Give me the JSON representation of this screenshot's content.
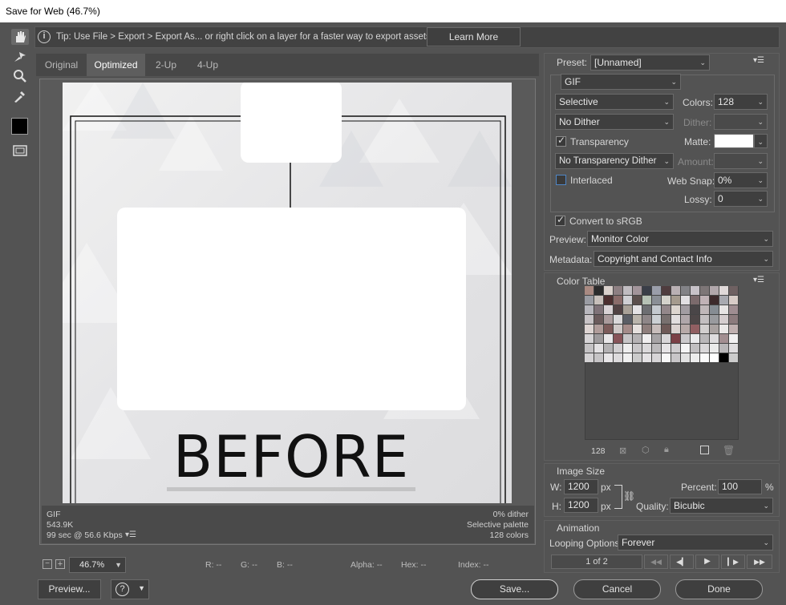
{
  "window": {
    "title": "Save for Web (46.7%)"
  },
  "tip": {
    "text": "Tip: Use File > Export > Export As...  or right click on a layer for a faster way to export assets",
    "learn_more": "Learn More"
  },
  "tools": [
    "hand-tool-icon",
    "slice-select-tool-icon",
    "zoom-tool-icon",
    "eyedropper-tool-icon",
    "eyedropper-color-swatch",
    "toggle-slices-icon"
  ],
  "tabs": [
    {
      "label": "Original"
    },
    {
      "label": "Optimized"
    },
    {
      "label": "2-Up"
    },
    {
      "label": "4-Up"
    }
  ],
  "preview_image": {
    "heading": "BEFORE"
  },
  "info": {
    "format": "GIF",
    "size": "543.9K",
    "time": "99 sec @ 56.6 Kbps",
    "dither": "0% dither",
    "palette": "Selective palette",
    "colors": "128 colors"
  },
  "status": {
    "zoom": "46.7%",
    "r": "R: --",
    "g": "G: --",
    "b": "B: --",
    "alpha": "Alpha: --",
    "hex": "Hex: --",
    "index": "Index: --"
  },
  "bottom_buttons": {
    "preview": "Preview...",
    "save": "Save...",
    "cancel": "Cancel",
    "done": "Done"
  },
  "preset": {
    "label": "Preset:",
    "value": "[Unnamed]"
  },
  "optimize": {
    "format": "GIF",
    "reduction": "Selective",
    "colors_label": "Colors:",
    "colors": "128",
    "dither_algo": "No Dither",
    "dither_label": "Dither:",
    "transparency_label": "Transparency",
    "transparency_checked": true,
    "matte_label": "Matte:",
    "transparency_dither": "No Transparency Dither",
    "amount_label": "Amount:",
    "interlaced_label": "Interlaced",
    "interlaced_checked": false,
    "websnap_label": "Web Snap:",
    "websnap": "0%",
    "lossy_label": "Lossy:",
    "lossy": "0"
  },
  "convert_srgb": {
    "label": "Convert to sRGB",
    "checked": true
  },
  "preview_setting": {
    "label": "Preview:",
    "value": "Monitor Color"
  },
  "metadata": {
    "label": "Metadata:",
    "value": "Copyright and Contact Info"
  },
  "color_table": {
    "title": "Color Table",
    "count": "128",
    "colors": [
      "#a98a82",
      "#2b2b2b",
      "#d9d0cb",
      "#8d7f82",
      "#c0bcc0",
      "#a2949a",
      "#3a3e48",
      "#9a9eaa",
      "#4f3c3e",
      "#b9b0b3",
      "#838387",
      "#c7c2c8",
      "#7d7677",
      "#b1a7ab",
      "#e0d9d9",
      "#6f6162",
      "#9a9ca3",
      "#c7bfba",
      "#4c2f2f",
      "#8a6c6a",
      "#cfcfd3",
      "#5b4f4d",
      "#b6c1b5",
      "#8a8f96",
      "#d4d2cb",
      "#a59b8e",
      "#e2e0e3",
      "#7b6a6c",
      "#c0b2b6",
      "#3d2a2c",
      "#a8a9b0",
      "#d8ccc7",
      "#b8b7bd",
      "#7f7278",
      "#d9d2d5",
      "#514243",
      "#a8a097",
      "#e4e2e5",
      "#6d6e72",
      "#c4c9cf",
      "#93878a",
      "#dcd5cf",
      "#a29da2",
      "#4a4648",
      "#bfb7b9",
      "#868c93",
      "#e7e4e4",
      "#9f8d91",
      "#c8c3c6",
      "#6b5b5c",
      "#aa9a9c",
      "#dad8da",
      "#5a5d65",
      "#bab4ac",
      "#8e8688",
      "#ccd0d4",
      "#78706f",
      "#e1dedf",
      "#b0a7aa",
      "#4e4748",
      "#c3bfc1",
      "#999a9e",
      "#d5cdcf",
      "#8c7b7d",
      "#ded5d3",
      "#b09c9a",
      "#7c5b5a",
      "#cfc8c7",
      "#a48b89",
      "#e6e0de",
      "#8e7e7c",
      "#c8bdbb",
      "#6e5957",
      "#dbd3d1",
      "#b8aaa8",
      "#915f62",
      "#d2cfcf",
      "#a9a2a1",
      "#ebe8e8",
      "#c0b0b0",
      "#d6d4d6",
      "#9d9a9c",
      "#e9e7e9",
      "#875459",
      "#c7c5c7",
      "#b5b2b4",
      "#f0eeef",
      "#a6a3a5",
      "#d8d6d8",
      "#7b4046",
      "#cbc9cb",
      "#eaeaec",
      "#b9b7b9",
      "#dedcde",
      "#a28e91",
      "#f2f1f2",
      "#c4c2c4",
      "#e3e1e3",
      "#b4b2b4",
      "#d2d0d2",
      "#eeeeee",
      "#c9c7c9",
      "#dbd9db",
      "#bcbabc",
      "#e6e4e6",
      "#cfcdcf",
      "#f5f5f5",
      "#c1bfc1",
      "#d9d7d9",
      "#ebebeb",
      "#b8b6b8",
      "#e0dee0",
      "#d4d2d4",
      "#c6c4c6",
      "#e8e6e8",
      "#dddbdd",
      "#f0f0f0",
      "#cbcbcb",
      "#e4e2e4",
      "#d7d5d7",
      "#f8f8f8",
      "#c8c6c8",
      "#e2e2e2",
      "#ededed",
      "#fafafa",
      "#ffffff",
      "#000000",
      "#cccccc"
    ]
  },
  "image_size": {
    "title": "Image Size",
    "w_label": "W:",
    "w": "1200",
    "h_label": "H:",
    "h": "1200",
    "unit": "px",
    "percent_label": "Percent:",
    "percent": "100",
    "percent_unit": "%",
    "quality_label": "Quality:",
    "quality": "Bicubic"
  },
  "animation": {
    "title": "Animation",
    "looping_label": "Looping Options:",
    "looping": "Forever",
    "frame": "1 of 2"
  },
  "colors": {
    "accent": "#ffffff",
    "panel": "#535353",
    "dark": "#3f3f3f"
  }
}
